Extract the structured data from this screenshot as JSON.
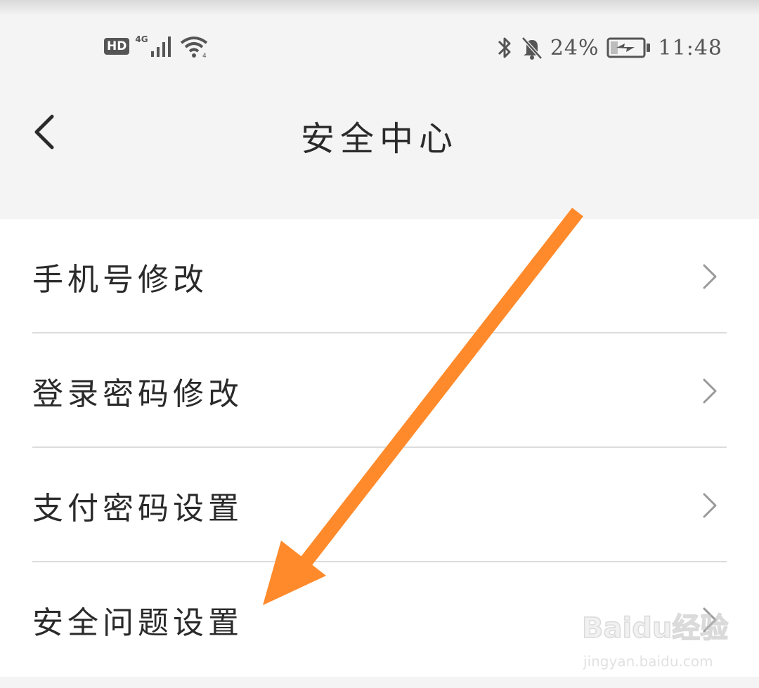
{
  "status_bar": {
    "hd_label": "HD",
    "network_type": "4G",
    "signal_icon": "signal-bars-icon",
    "wifi_icon": "wifi-icon",
    "bluetooth_icon": "bluetooth-icon",
    "mute_icon": "bell-off-icon",
    "battery_percent": "24%",
    "battery_icon": "battery-charging-icon",
    "time": "11:48"
  },
  "header": {
    "title": "安全中心",
    "back_icon": "chevron-left-icon"
  },
  "menu": {
    "items": [
      {
        "label": "手机号修改"
      },
      {
        "label": "登录密码修改"
      },
      {
        "label": "支付密码设置"
      },
      {
        "label": "安全问题设置"
      }
    ],
    "chevron_icon": "chevron-right-icon"
  },
  "annotation": {
    "arrow_color": "#ff8a2b",
    "arrow_icon": "arrow-annotation-icon"
  },
  "watermark": {
    "brand": "Baidu经验",
    "url": "jingyan.baidu.com"
  },
  "colors": {
    "background": "#f4f4f4",
    "panel": "#ffffff",
    "text": "#2a2a2a",
    "divider": "#dcdcdc",
    "chevron": "#9a9a9a"
  }
}
